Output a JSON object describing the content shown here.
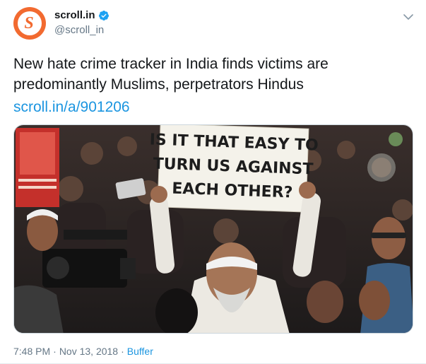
{
  "account": {
    "display_name": "scroll.in",
    "handle": "@scroll_in",
    "avatar_letter": "S",
    "verified": true,
    "brand_color": "#f26a30"
  },
  "tweet": {
    "text": "New hate crime tracker in India finds victims are predominantly Muslims, perpetrators Hindus",
    "link": "scroll.in/a/901206",
    "time": "7:48 PM",
    "date": "Nov 13, 2018",
    "source": "Buffer",
    "separator": "·"
  },
  "media": {
    "sign_lines": [
      "IS IT THAT EASY TO",
      "TURN US AGAINST",
      "EACH OTHER?"
    ]
  },
  "colors": {
    "link": "#1b95e0",
    "secondary_text": "#657786",
    "verified_badge": "#1da1f2"
  },
  "icons": {
    "verified": "verified-badge-icon",
    "menu": "chevron-down-icon"
  }
}
